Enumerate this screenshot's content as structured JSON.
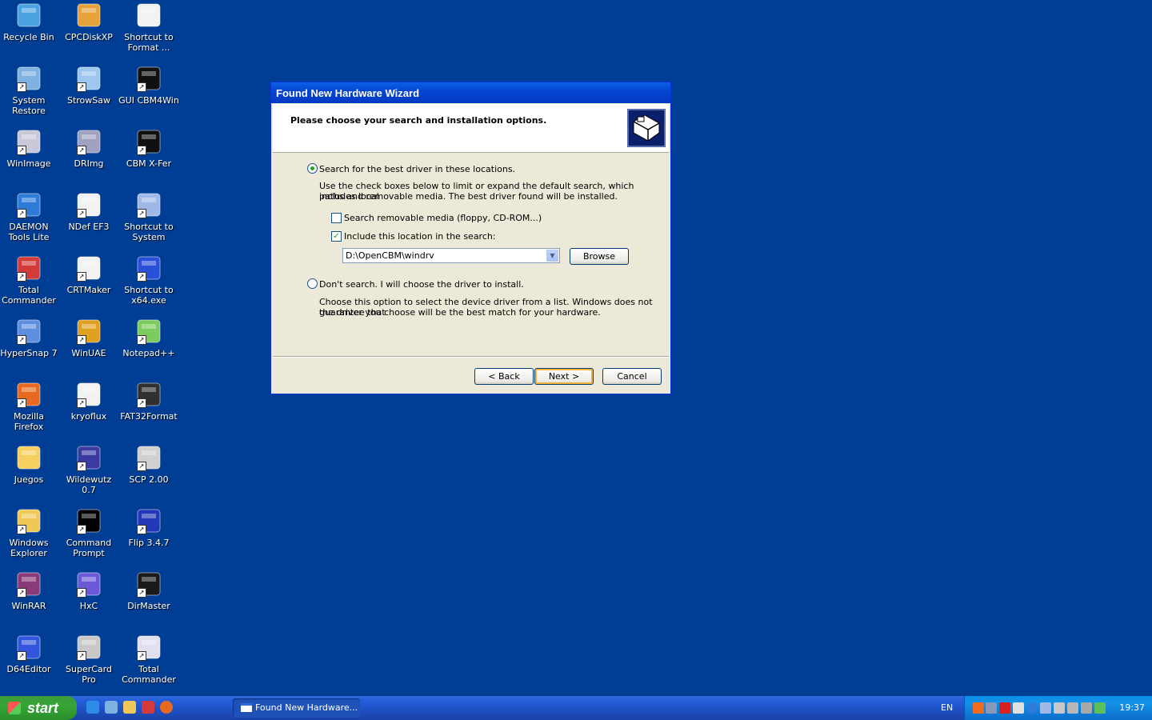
{
  "desktop": {
    "icons": [
      {
        "label": "Recycle Bin",
        "color": "#4AA3E0"
      },
      {
        "label": "CPCDiskXP",
        "color": "#E8A23C"
      },
      {
        "label": "Shortcut to Format ...",
        "color": "#F2F2F2"
      },
      {
        "label": "System Restore",
        "color": "#7FB2E0"
      },
      {
        "label": "StrowSaw",
        "color": "#9EC7F0"
      },
      {
        "label": "GUI CBM4Win",
        "color": "#101010"
      },
      {
        "label": "WinImage",
        "color": "#C8C8D8"
      },
      {
        "label": "DRImg",
        "color": "#A0A0C0"
      },
      {
        "label": "CBM X-Fer",
        "color": "#101010"
      },
      {
        "label": "DAEMON Tools Lite",
        "color": "#2C7BD8"
      },
      {
        "label": "NDef EF3",
        "color": "#F2F2F2"
      },
      {
        "label": "Shortcut to System",
        "color": "#9FB8E8"
      },
      {
        "label": "Total Commander",
        "color": "#D33A3A"
      },
      {
        "label": "CRTMaker",
        "color": "#F2F2F2"
      },
      {
        "label": "Shortcut to x64.exe",
        "color": "#2A4FD8"
      },
      {
        "label": "HyperSnap 7",
        "color": "#5E8EE0"
      },
      {
        "label": "WinUAE",
        "color": "#E0A020"
      },
      {
        "label": "Notepad++",
        "color": "#7BCB5E"
      },
      {
        "label": "Mozilla Firefox",
        "color": "#E86A20"
      },
      {
        "label": "kryoflux",
        "color": "#F2F2F2"
      },
      {
        "label": "FAT32Format",
        "color": "#303030"
      },
      {
        "label": "Juegos",
        "color": "#F5D061"
      },
      {
        "label": "Wildewutz 0.7",
        "color": "#3A3AA0"
      },
      {
        "label": "SCP 2.00",
        "color": "#D0D0D0"
      },
      {
        "label": "Windows Explorer",
        "color": "#F0C858"
      },
      {
        "label": "Command Prompt",
        "color": "#000000"
      },
      {
        "label": "Flip 3.4.7",
        "color": "#2238B8"
      },
      {
        "label": "WinRAR",
        "color": "#8A3A7A"
      },
      {
        "label": "HxC",
        "color": "#6A5AD8"
      },
      {
        "label": "DirMaster",
        "color": "#1A1A1A"
      },
      {
        "label": "D64Editor",
        "color": "#3355DD"
      },
      {
        "label": "SuperCard Pro",
        "color": "#C8C8C8"
      },
      {
        "label": "Total Commander",
        "color": "#E0E0F0"
      }
    ]
  },
  "wizard": {
    "title": "Found New Hardware Wizard",
    "heading": "Please choose your search and installation options.",
    "option_search_label": "Search for the best driver in these locations.",
    "option_search_desc_1": "Use the check boxes below to limit or expand the default search, which includes local",
    "option_search_desc_2": "paths and removable media. The best driver found will be installed.",
    "check_removable_label": "Search removable media (floppy, CD-ROM...)",
    "check_removable_checked": false,
    "check_location_label": "Include this location in the search:",
    "check_location_checked": true,
    "location_value": "D:\\OpenCBM\\windrv",
    "browse_label": "Browse",
    "option_dont_search_label": "Don't search. I will choose the driver to install.",
    "option_dont_desc_1": "Choose this option to select the device driver from a list.  Windows does not guarantee that",
    "option_dont_desc_2": "the driver you choose will be the best match for your hardware.",
    "back_label": "< Back",
    "next_label": "Next >",
    "cancel_label": "Cancel"
  },
  "taskbar": {
    "start_label": "start",
    "task_button_label": "Found New Hardware...",
    "language": "EN",
    "clock": "19:37"
  }
}
